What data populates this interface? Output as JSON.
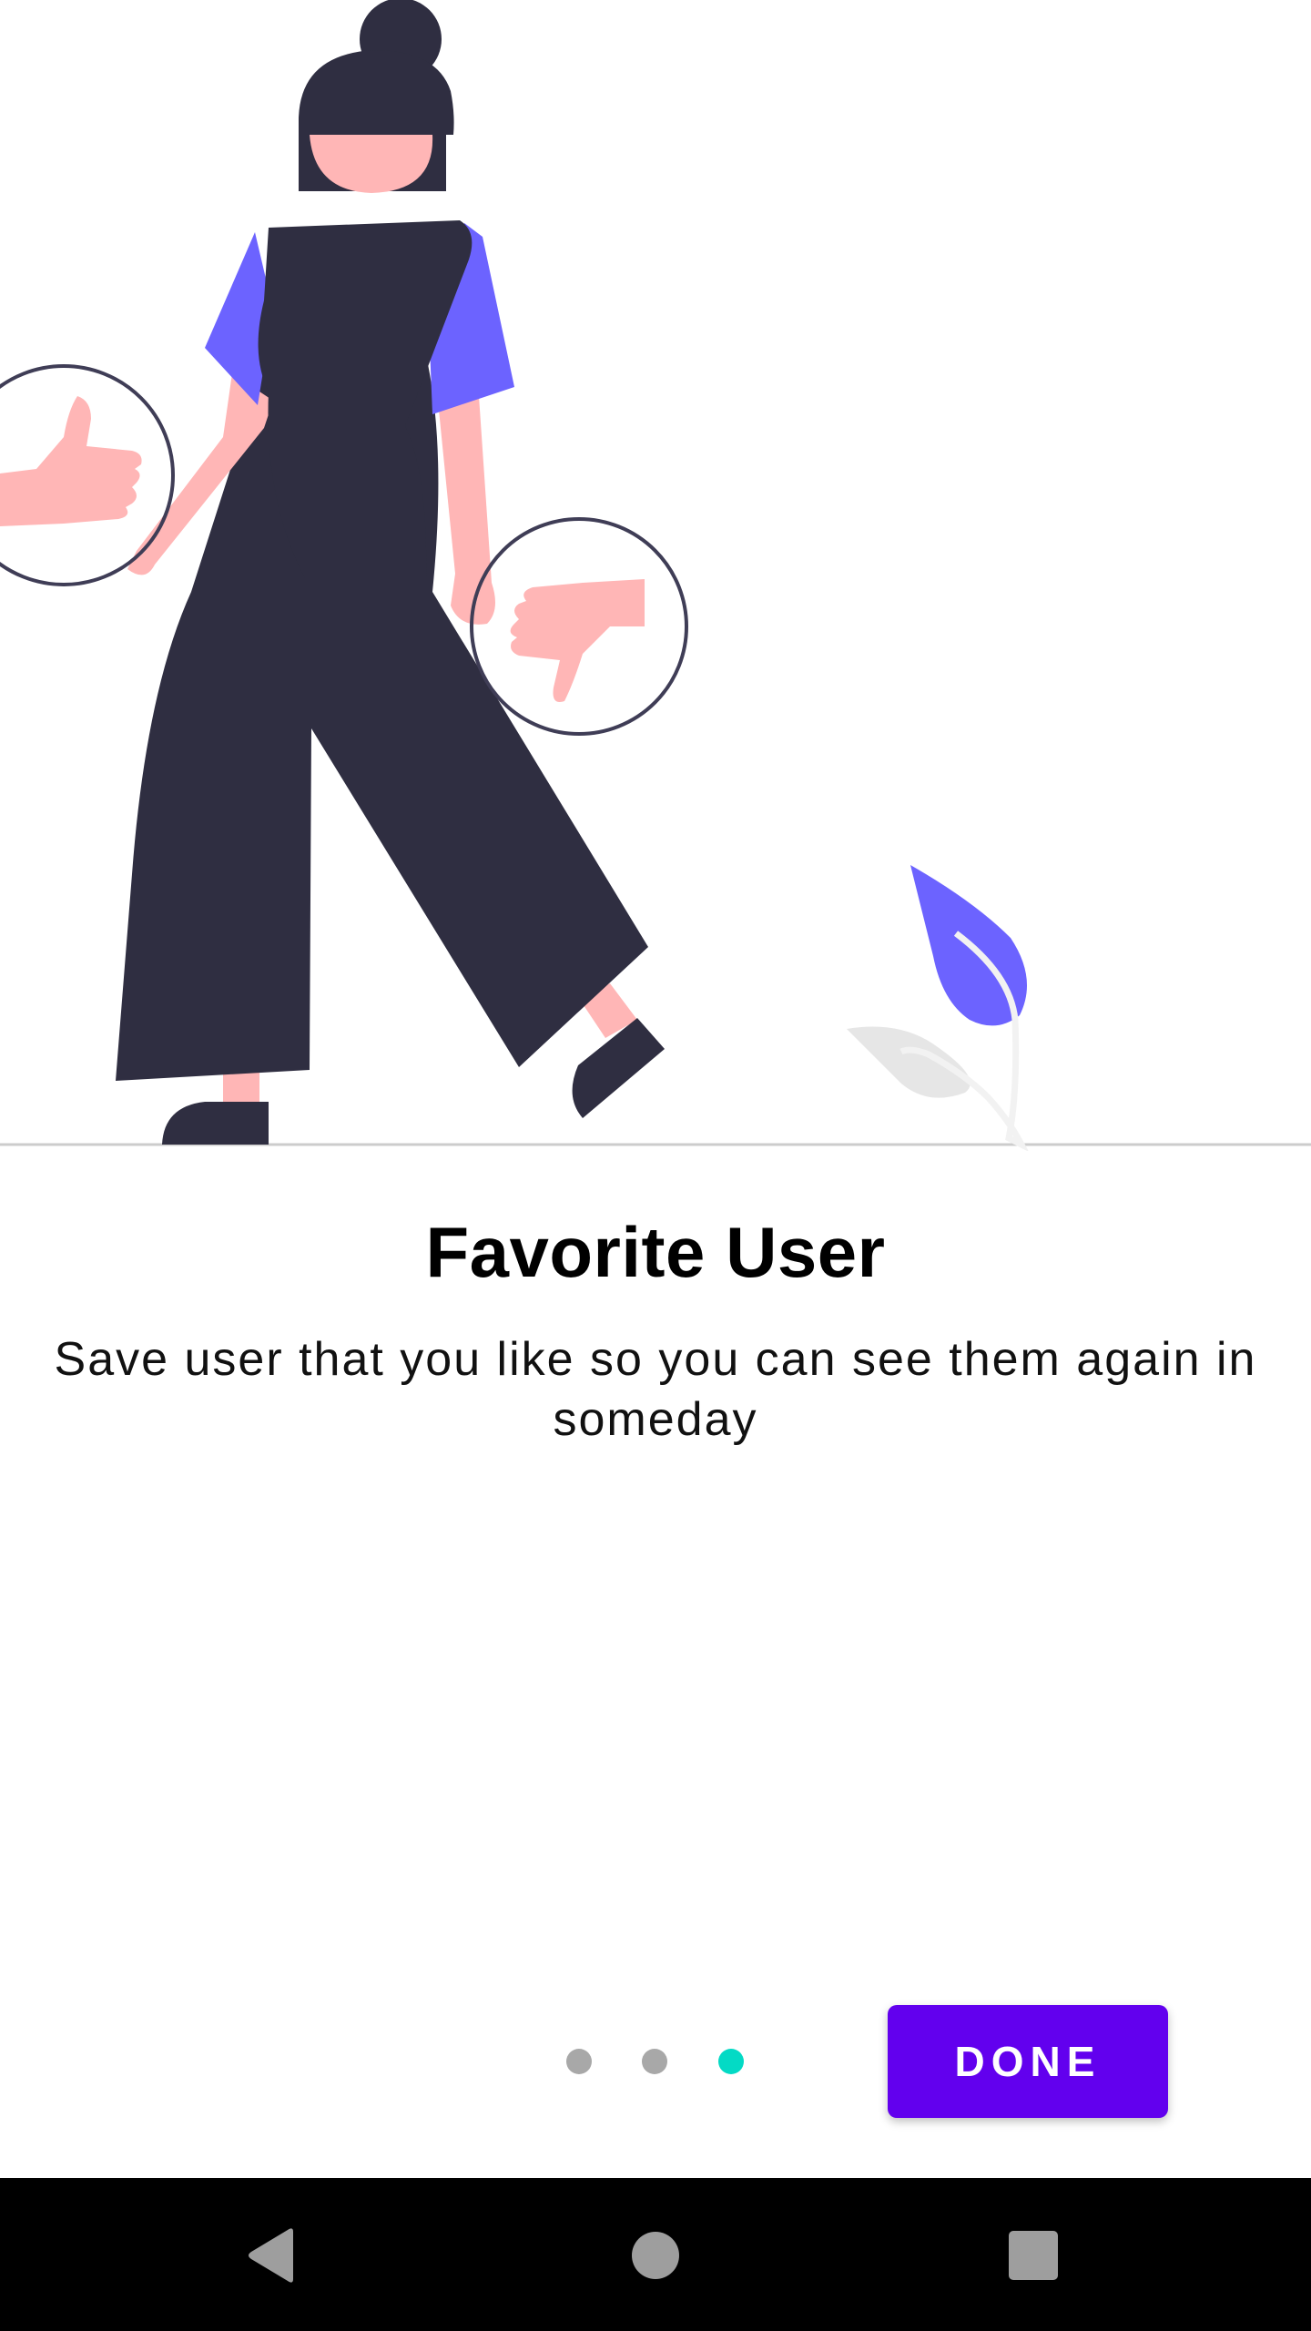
{
  "onboarding": {
    "title": "Favorite User",
    "description": "Save user that you like so you can see them again in someday",
    "done_label": "DONE",
    "page_indicator": {
      "total_pages": 3,
      "current_page": 3
    }
  },
  "colors": {
    "accent": "#6200EE",
    "indicator_active": "#03DAC5",
    "indicator_inactive": "#A8A8A8",
    "illustration_dark": "#2F2E41",
    "illustration_skin": "#FFB6B6",
    "illustration_purple": "#6C63FF"
  },
  "icons": {
    "back": "back-triangle-icon",
    "home": "home-circle-icon",
    "recents": "recents-square-icon"
  }
}
